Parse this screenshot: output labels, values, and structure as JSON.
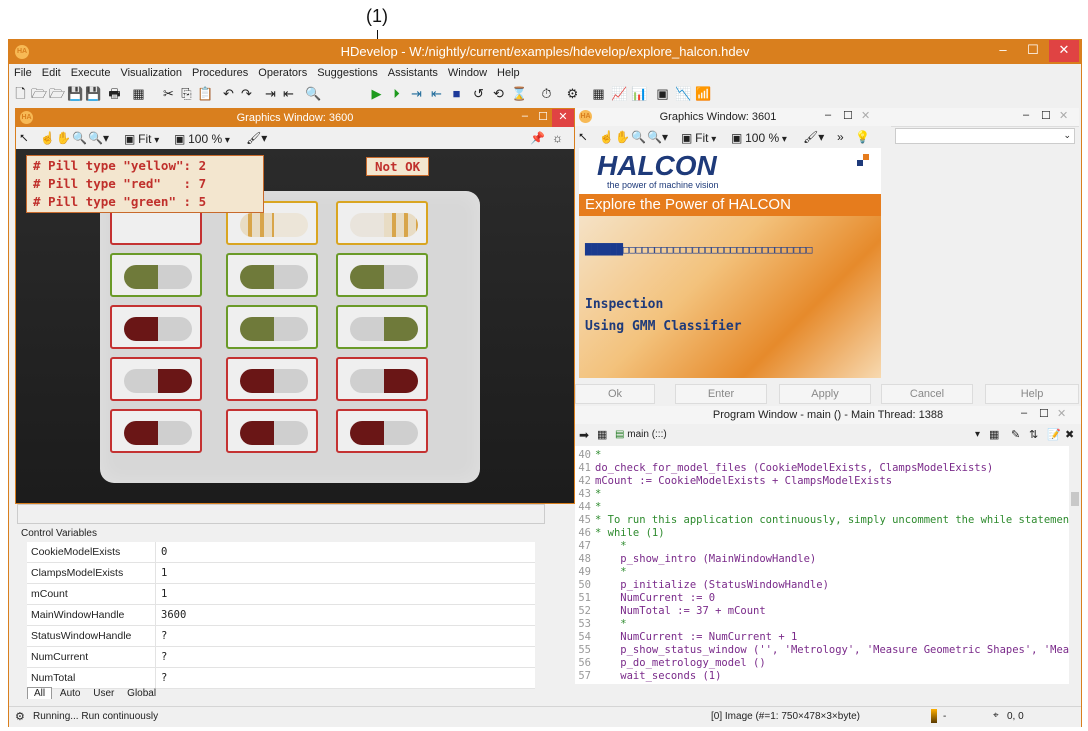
{
  "annotation": {
    "label": "(1)"
  },
  "window": {
    "title": "HDevelop - W:/nightly/current/examples/hdevelop/explore_halcon.hdev",
    "logo": "HA"
  },
  "menu": [
    "File",
    "Edit",
    "Execute",
    "Visualization",
    "Procedures",
    "Operators",
    "Suggestions",
    "Assistants",
    "Window",
    "Help"
  ],
  "graphics_main": {
    "title": "Graphics Window: 3600",
    "fit_label": "Fit",
    "zoom_label": "100 %",
    "overlay_lines": [
      "# Pill type \"yellow\": 2",
      "# Pill type \"red\"   : 7",
      "# Pill type \"green\" : 5"
    ],
    "status_text": "Not OK"
  },
  "graphics_second": {
    "title": "Graphics Window: 3601",
    "fit_label": "Fit",
    "zoom_label": "100 %",
    "brand": "HALCON",
    "brand_tagline": "the power of machine vision",
    "banner": "Explore the Power of HALCON",
    "progress_text": "██████□□□□□□□□□□□□□□□□□□□□□□□□□□□□□□",
    "inspect_line1": "Inspection",
    "inspect_line2": "Using GMM Classifier"
  },
  "dialog_buttons": [
    "Ok",
    "Enter",
    "Apply",
    "Cancel",
    "Help"
  ],
  "program_window": {
    "title": "Program Window - main () - Main Thread: 1388",
    "procedure": "main (:::)",
    "lines": [
      {
        "n": "40",
        "t": "*",
        "c": "#2e8b2e"
      },
      {
        "n": "41",
        "t": "do_check_for_model_files (CookieModelExists, ClampsModelExists)",
        "c": "#7a2a8a"
      },
      {
        "n": "42",
        "t": "mCount := CookieModelExists + ClampsModelExists",
        "c": "#7a2a8a"
      },
      {
        "n": "43",
        "t": "*",
        "c": "#2e8b2e"
      },
      {
        "n": "44",
        "t": "*",
        "c": "#2e8b2e"
      },
      {
        "n": "45",
        "t": "* To run this application continuously, simply uncomment the while statement:",
        "c": "#2e8b2e"
      },
      {
        "n": "46",
        "t": "* while (1)",
        "c": "#2e8b2e"
      },
      {
        "n": "47",
        "t": "    *",
        "c": "#2e8b2e"
      },
      {
        "n": "48",
        "t": "    p_show_intro (MainWindowHandle)",
        "c": "#7a2a8a"
      },
      {
        "n": "49",
        "t": "    *",
        "c": "#2e8b2e"
      },
      {
        "n": "50",
        "t": "    p_initialize (StatusWindowHandle)",
        "c": "#7a2a8a"
      },
      {
        "n": "51",
        "t": "    NumCurrent := 0",
        "c": "#7a2a8a"
      },
      {
        "n": "52",
        "t": "    NumTotal := 37 + mCount",
        "c": "#7a2a8a"
      },
      {
        "n": "53",
        "t": "    *",
        "c": "#2e8b2e"
      },
      {
        "n": "54",
        "t": "    NumCurrent := NumCurrent + 1",
        "c": "#7a2a8a"
      },
      {
        "n": "55",
        "t": "    p_show_status_window ('', 'Metrology', 'Measure Geometric Shapes', 'Measur",
        "c": "#7a2a8a"
      },
      {
        "n": "56",
        "t": "    p_do_metrology_model ()",
        "c": "#7a2a8a"
      },
      {
        "n": "57",
        "t": "    wait_seconds (1)",
        "c": "#7a2a8a"
      }
    ]
  },
  "control_variables": {
    "label": "Control Variables",
    "rows": [
      {
        "name": "CookieModelExists",
        "value": "0"
      },
      {
        "name": "ClampsModelExists",
        "value": "1"
      },
      {
        "name": "mCount",
        "value": "1"
      },
      {
        "name": "MainWindowHandle",
        "value": "3600"
      },
      {
        "name": "StatusWindowHandle",
        "value": "?"
      },
      {
        "name": "NumCurrent",
        "value": "?"
      },
      {
        "name": "NumTotal",
        "value": "?"
      }
    ],
    "tabs": [
      "All",
      "Auto",
      "User",
      "Global"
    ]
  },
  "statusbar": {
    "text": "Running... Run continuously",
    "image_info": "[0] Image (#=1: 750×478×3×byte)",
    "color": "-",
    "coords": "0, 0"
  },
  "colors": {
    "accent": "#d97f1e",
    "halcon_blue": "#1e3a7a",
    "pill_red": "#7a1b1b",
    "pill_green": "#6f7a3a"
  }
}
